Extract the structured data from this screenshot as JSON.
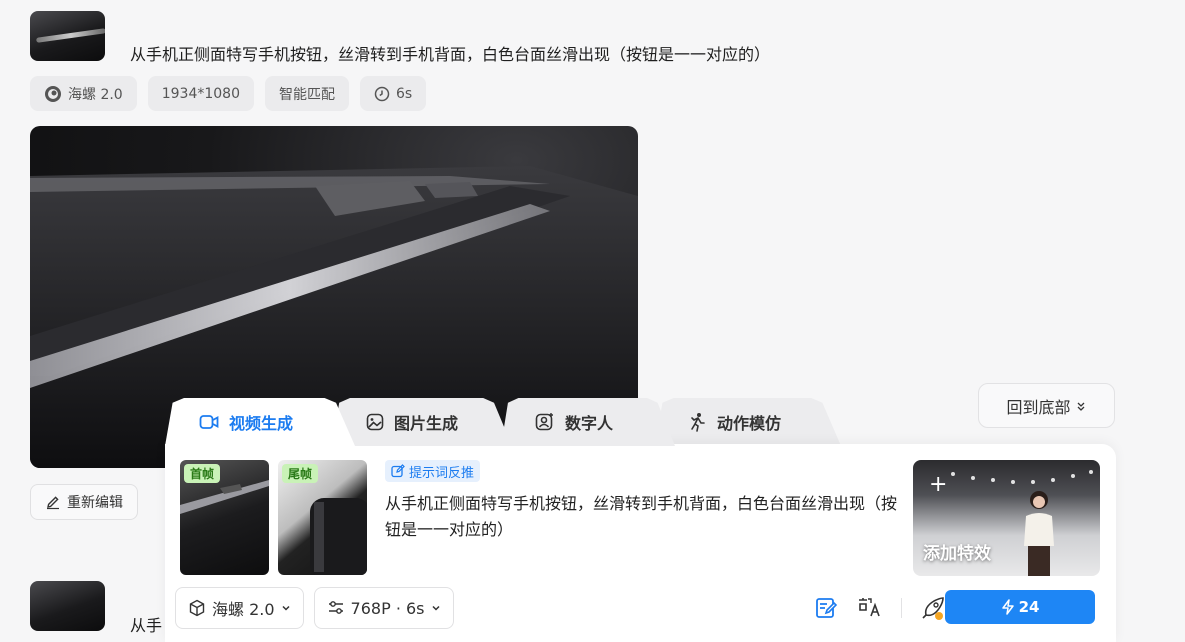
{
  "history": {
    "prompt": "从手机正侧面特写手机按钮，丝滑转到手机背面，白色台面丝滑出现（按钮是一一对应的）",
    "prompt_next_partial": "从手",
    "chips": {
      "model": "海螺 2.0",
      "resolution": "1934*1080",
      "mode": "智能匹配",
      "duration": "6s"
    },
    "actions": {
      "re_edit": "重新编辑"
    }
  },
  "back_to_bottom": "回到底部",
  "composer": {
    "tabs": [
      {
        "label": "视频生成",
        "active": true
      },
      {
        "label": "图片生成",
        "active": false
      },
      {
        "label": "数字人",
        "active": false
      },
      {
        "label": "动作模仿",
        "active": false
      }
    ],
    "first_frame_tag": "首帧",
    "last_frame_tag": "尾帧",
    "hint_label": "提示词反推",
    "prompt": "从手机正侧面特写手机按钮，丝滑转到手机背面，白色台面丝滑出现（按钮是一一对应的）",
    "effect_label": "添加特效",
    "model_select": "海螺 2.0",
    "quality_select": "768P · 6s",
    "credits": "24"
  },
  "colors": {
    "accent": "#1e86f5",
    "tab_active": "#1c7cf0",
    "frame_tag_bg": "#c9f2b7"
  }
}
